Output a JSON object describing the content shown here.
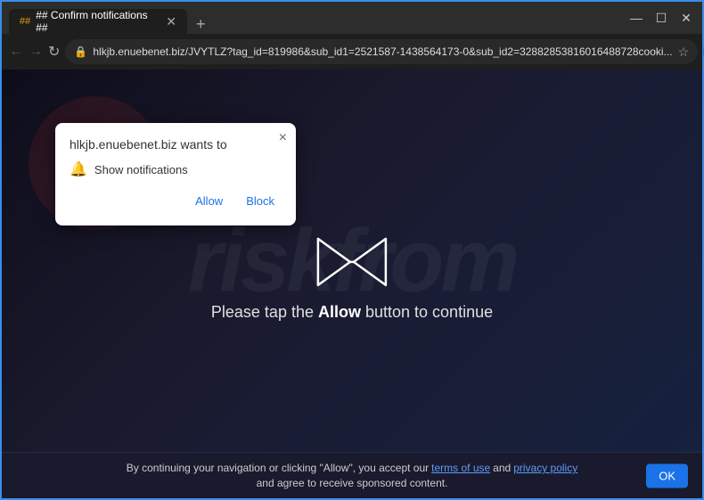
{
  "browser": {
    "tab": {
      "label": "## Confirm notifications ##",
      "icon": "##"
    },
    "new_tab_btn": "+",
    "window_controls": {
      "minimize": "—",
      "maximize": "☐",
      "close": "✕"
    },
    "nav": {
      "back_disabled": true,
      "forward_disabled": true,
      "reload": "↻",
      "address": "hlkjb.enuebenet.biz/JVYTLZ?tag_id=819986&sub_id1=2521587-1438564173-0&sub_id2=32882853816016488728cooki...",
      "star": "☆",
      "menu": "⋮"
    }
  },
  "notification_popup": {
    "title": "hlkjb.enuebenet.biz wants to",
    "close": "×",
    "row_text": "Show notifications",
    "allow_label": "Allow",
    "block_label": "Block"
  },
  "page": {
    "watermark": "riskfrom",
    "main_text_before": "Please tap the ",
    "main_text_bold": "Allow",
    "main_text_after": " button to continue"
  },
  "footer": {
    "text1": "By continuing your navigation or clicking \"Allow\", you accept our",
    "link1": "terms of use",
    "text2": "and",
    "link2": "privacy policy",
    "text3": "and agree to receive sponsored content.",
    "ok_label": "OK"
  }
}
